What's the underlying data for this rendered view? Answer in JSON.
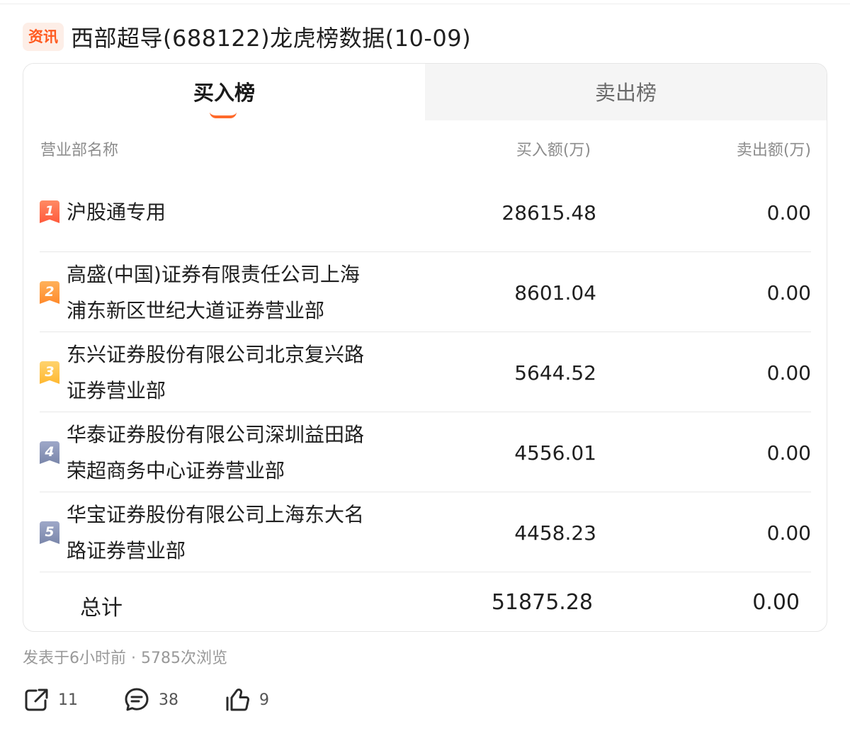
{
  "article": {
    "badge": "资讯",
    "title": "西部超导(688122)龙虎榜数据(10-09)"
  },
  "tabs": [
    {
      "label": "买入榜",
      "active": true
    },
    {
      "label": "卖出榜",
      "active": false
    }
  ],
  "columns": {
    "name": "营业部名称",
    "buy": "买入额(万)",
    "sell": "卖出额(万)"
  },
  "rows": [
    {
      "rank": "1",
      "name_line1": "沪股通专用",
      "name_line2": "",
      "buy": "28615.48",
      "sell": "0.00"
    },
    {
      "rank": "2",
      "name_line1": "高盛(中国)证券有限责任公司上海",
      "name_line2": "浦东新区世纪大道证券营业部",
      "buy": "8601.04",
      "sell": "0.00"
    },
    {
      "rank": "3",
      "name_line1": "东兴证券股份有限公司北京复兴路",
      "name_line2": "证券营业部",
      "buy": "5644.52",
      "sell": "0.00"
    },
    {
      "rank": "4",
      "name_line1": "华泰证券股份有限公司深圳益田路",
      "name_line2": "荣超商务中心证券营业部",
      "buy": "4556.01",
      "sell": "0.00"
    },
    {
      "rank": "5",
      "name_line1": "华宝证券股份有限公司上海东大名",
      "name_line2": "路证券营业部",
      "buy": "4458.23",
      "sell": "0.00"
    }
  ],
  "total": {
    "label": "总计",
    "buy": "51875.28",
    "sell": "0.00"
  },
  "meta": "发表于6小时前 · 5785次浏览",
  "actions": {
    "share_count": "11",
    "comment_count": "38",
    "like_count": "9"
  },
  "colors": {
    "accent": "#ff5a1f",
    "rank_1": "#ff6a45",
    "rank_2": "#ff9a3a",
    "rank_3": "#ffc44a",
    "rank_4_5": "#8a95b8"
  }
}
